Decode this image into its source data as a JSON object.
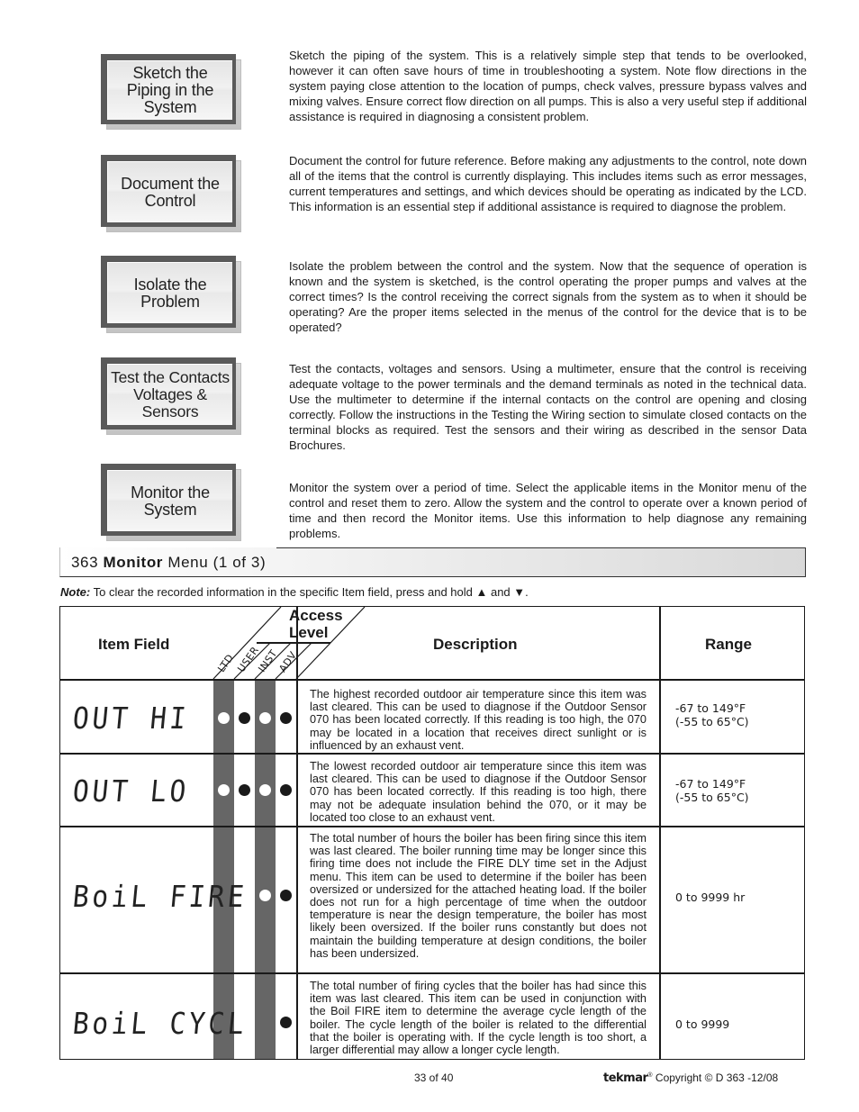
{
  "steps": [
    {
      "label": "Sketch the\nPiping in the\nSystem",
      "text": "Sketch the piping of the system. This is a relatively simple step that tends to be overlooked, however it can often save hours of time in troubleshooting a system. Note flow directions in the system paying close attention to the location of pumps, check valves, pressure bypass valves and mixing valves. Ensure correct flow direction on all pumps. This is also a very useful step if additional assistance is required in diagnosing a consistent problem."
    },
    {
      "label": "Document the\nControl",
      "text": "Document the control for future reference. Before making any adjustments to the control, note down all of the items that the control is currently displaying. This includes items such as error messages, current temperatures and settings, and which devices should be operating as indicated by the LCD. This information is an essential step if additional assistance is required to diagnose the problem."
    },
    {
      "label": "Isolate the\nProblem",
      "text": "Isolate the problem between the control and the system. Now that the sequence of operation is known and the system is sketched, is the control operating the proper pumps and valves at the correct times? Is the control receiving the correct signals from the system as to when it should be operating? Are the proper items selected in the menus of the control for the device that is to be operated?"
    },
    {
      "label": "Test the Contacts\nVoltages &\nSensors",
      "text": "Test the contacts, voltages and sensors. Using a multimeter, ensure that the control is receiving adequate voltage to the power terminals and the demand terminals as noted in the technical data. Use the multimeter to determine if the internal contacts on the control are opening and closing correctly. Follow the instructions in the Testing the Wiring section to simulate closed contacts on the terminal blocks as required. Test the sensors and their wiring as described in the sensor Data Brochures."
    },
    {
      "label": "Monitor the\nSystem",
      "text": "Monitor the system over a period of time. Select the applicable items in the Monitor menu of the control and reset them to zero. Allow the system and the control to operate over a known period of time and then record the Monitor items. Use this information to help diagnose any remaining problems."
    }
  ],
  "section": {
    "prefix": "363 ",
    "bold": "Monitor",
    "suffix": " Menu (1 of 3)"
  },
  "note": {
    "label": "Note:",
    "text": " To clear the recorded information in the specific Item field, press and hold ",
    "up_icon": "▲",
    "and": " and ",
    "down_icon": "▼",
    "end": "."
  },
  "table": {
    "headers": {
      "item_field": "Item Field",
      "access_level": "Access\nLevel",
      "description": "Description",
      "range": "Range"
    },
    "levels": [
      "LTD",
      "USER",
      "INST",
      "ADV"
    ],
    "rows": [
      {
        "lcd": "OUT HI",
        "access": [
          "white",
          "black",
          "white",
          "black"
        ],
        "description": "The highest recorded outdoor air temperature since this item was last cleared. This can be used to diagnose if the Outdoor Sensor 070 has been located correctly. If this reading is too high, the 070 may be located in a location that receives direct sunlight or is influenced by an exhaust vent.",
        "range": "-67 to 149°F\n(-55 to 65°C)"
      },
      {
        "lcd": "OUT LO",
        "access": [
          "white",
          "black",
          "white",
          "black"
        ],
        "description": "The lowest recorded outdoor air temperature since this item was last cleared. This can be used to diagnose if the Outdoor Sensor 070 has been located correctly. If this reading is too high, there may not be adequate insulation behind the 070, or it may be located too close to an exhaust vent.",
        "range": "-67 to 149°F\n(-55 to 65°C)"
      },
      {
        "lcd": "BoiL FIRE",
        "access": [
          null,
          null,
          "white",
          "black"
        ],
        "description": "The total number of hours the boiler has been firing since this item was last cleared. The boiler running time may be longer since this firing time does not include the FIRE DLY time set in the Adjust menu. This item can be used to determine if the boiler has been oversized or undersized for the attached heating load. If the boiler does not run for a high percentage of time when the outdoor temperature is near the design temperature, the boiler has most likely been oversized. If the boiler runs constantly but does not maintain the building temperature at design conditions, the boiler has been undersized.",
        "range": "0 to 9999 hr"
      },
      {
        "lcd": "BoiL CYCL",
        "access": [
          null,
          null,
          null,
          "black"
        ],
        "description": "The total number of firing cycles that the boiler has had since this item was last cleared. This item can be used in conjunction with the Boil FIRE item to determine the average cycle length of the boiler. The cycle length of the boiler is related to the differential that the boiler is operating with. If the cycle length is too short, a larger differential may allow a longer cycle length.",
        "range": "0 to 9999"
      }
    ]
  },
  "footer": {
    "page": "33 of 40",
    "brand": "tekmar",
    "registered": "®",
    "copyright": " Copyright © D 363 -12/08"
  }
}
